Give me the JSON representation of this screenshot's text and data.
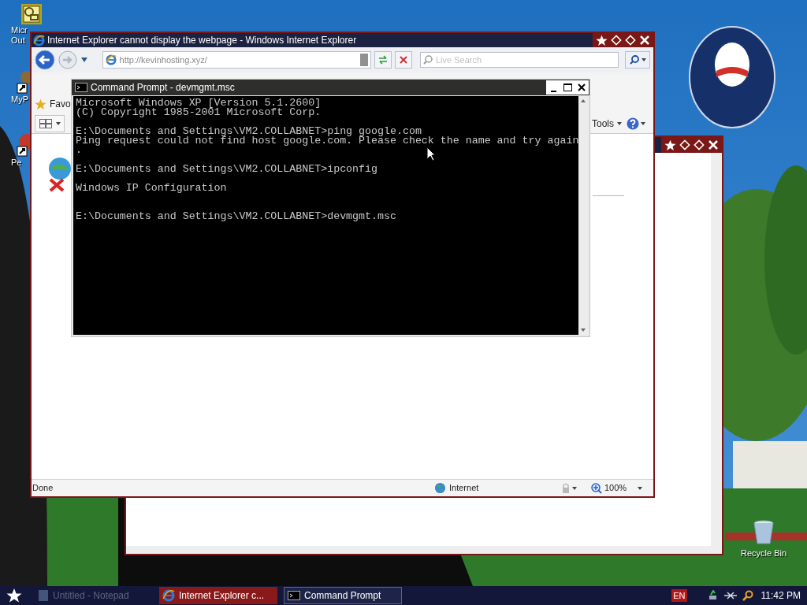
{
  "desktop_icons": [
    {
      "kind": "outlook",
      "lines": [
        "Micr",
        "Out"
      ]
    },
    {
      "kind": "shortcut",
      "lines": [
        "MyP"
      ]
    },
    {
      "kind": "app",
      "lines": [
        "Pe"
      ]
    },
    {
      "kind": "recycle",
      "lines": [
        "Recycle Bin"
      ]
    }
  ],
  "ie_window": {
    "title": "Internet Explorer cannot display the webpage - Windows Internet Explorer",
    "address": "http://kevinhosting.xyz/",
    "search_placeholder": "Live Search",
    "favorites": "Favo",
    "tools": "Tools",
    "status": "Done",
    "zone": "Internet",
    "zoom": "100%"
  },
  "cmd_window": {
    "title": "Command Prompt - devmgmt.msc",
    "lines": [
      {
        "kind": "text",
        "text": "Microsoft Windows XP [Version 5.1.2600]"
      },
      {
        "kind": "text",
        "text": "(C) Copyright 1985-2001 Microsoft Corp."
      },
      {
        "kind": "blank"
      },
      {
        "kind": "text",
        "text": "E:\\Documents and Settings\\VM2.COLLABNET>ping google.com"
      },
      {
        "kind": "text",
        "text": "Ping request could not find host google.com. Please check the name and try again"
      },
      {
        "kind": "text",
        "text": "."
      },
      {
        "kind": "blank"
      },
      {
        "kind": "text",
        "text": "E:\\Documents and Settings\\VM2.COLLABNET>ipconfig"
      },
      {
        "kind": "blank"
      },
      {
        "kind": "text",
        "text": "Windows IP Configuration"
      },
      {
        "kind": "blank"
      },
      {
        "kind": "blank"
      },
      {
        "kind": "text",
        "text": "E:\\Documents and Settings\\VM2.COLLABNET>devmgmt.msc"
      }
    ]
  },
  "taskbar": {
    "items": [
      {
        "kind": "notepad",
        "label": "Untitled - Notepad",
        "selected": false,
        "faded": true
      },
      {
        "kind": "ie",
        "label": "Internet Explorer c...",
        "selected": false,
        "faded": false
      },
      {
        "kind": "cmd",
        "label": "Command Prompt",
        "selected": true,
        "faded": false
      }
    ],
    "language": "EN",
    "clock": "11:42 PM"
  }
}
